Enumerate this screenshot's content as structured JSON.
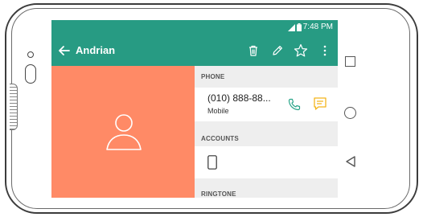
{
  "status_bar": {
    "time": "7:48 PM"
  },
  "app_bar": {
    "title": "Andrian",
    "back_icon": "arrow-left-icon",
    "actions": [
      "delete-icon",
      "edit-pencil-icon",
      "star-outline-icon",
      "more-vert-icon"
    ]
  },
  "photo": {
    "icon": "person-outline-icon",
    "background_color": "#ff8a66"
  },
  "details": {
    "phone_header": "PHONE",
    "phone_number": "(010) 888-88...",
    "phone_type": "Mobile",
    "accounts_header": "ACCOUNTS",
    "ringtone_header": "RINGTONE"
  },
  "colors": {
    "app_bar": "#279b83",
    "accent_green": "#2aa58a",
    "message_yellow": "#f3b51b"
  },
  "nav_bar": {
    "recents_icon": "square-icon",
    "home_icon": "circle-icon",
    "back_icon": "triangle-back-icon"
  }
}
